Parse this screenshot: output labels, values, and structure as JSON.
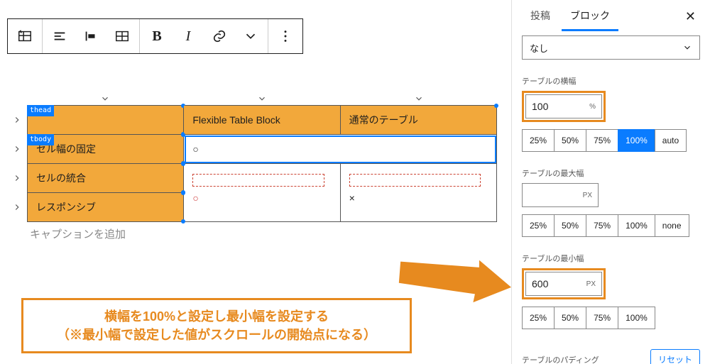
{
  "sidebar": {
    "tabs": {
      "post": "投稿",
      "block": "ブロック"
    },
    "select_value": "なし",
    "width": {
      "label": "テーブルの横幅",
      "value": "100",
      "unit": "%"
    },
    "width_presets": [
      "25%",
      "50%",
      "75%",
      "100%",
      "auto"
    ],
    "width_active": "100%",
    "maxwidth": {
      "label": "テーブルの最大幅",
      "value": "",
      "unit": "PX"
    },
    "maxwidth_presets": [
      "25%",
      "50%",
      "75%",
      "100%",
      "none"
    ],
    "minwidth": {
      "label": "テーブルの最小幅",
      "value": "600",
      "unit": "PX"
    },
    "minwidth_presets": [
      "25%",
      "50%",
      "75%",
      "100%"
    ],
    "padding_label": "テーブルのパディング",
    "reset_label": "リセット"
  },
  "table": {
    "thead_tag": "thead",
    "tbody_tag": "tbody",
    "headers": [
      "",
      "Flexible Table Block",
      "通常のテーブル"
    ],
    "rows": [
      {
        "head": "セル幅の固定",
        "c1": "○",
        "c2": ""
      },
      {
        "head": "セルの統合",
        "c1": "○",
        "c2": "×"
      },
      {
        "head": "レスポンシブ",
        "c1": "",
        "c2": ""
      }
    ],
    "caption_placeholder": "キャプションを追加"
  },
  "callout": {
    "line1": "横幅を100%と設定し最小幅を設定する",
    "line2": "（※最小幅で設定した値がスクロールの開始点になる）"
  }
}
